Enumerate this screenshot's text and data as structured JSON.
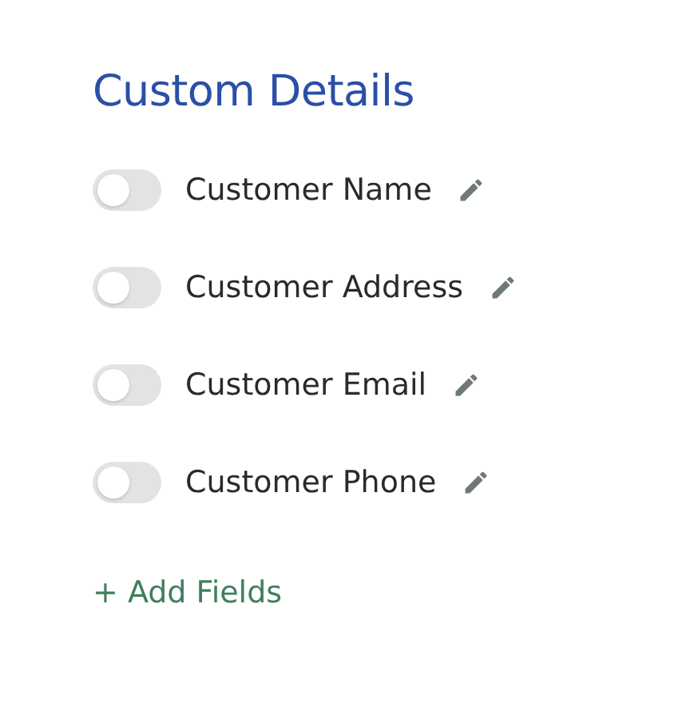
{
  "title": "Custom Details",
  "fields": [
    {
      "label": "Customer Name",
      "on": false
    },
    {
      "label": "Customer Address",
      "on": false
    },
    {
      "label": "Customer Email",
      "on": false
    },
    {
      "label": "Customer Phone",
      "on": false
    }
  ],
  "add_link": "+ Add Fields"
}
